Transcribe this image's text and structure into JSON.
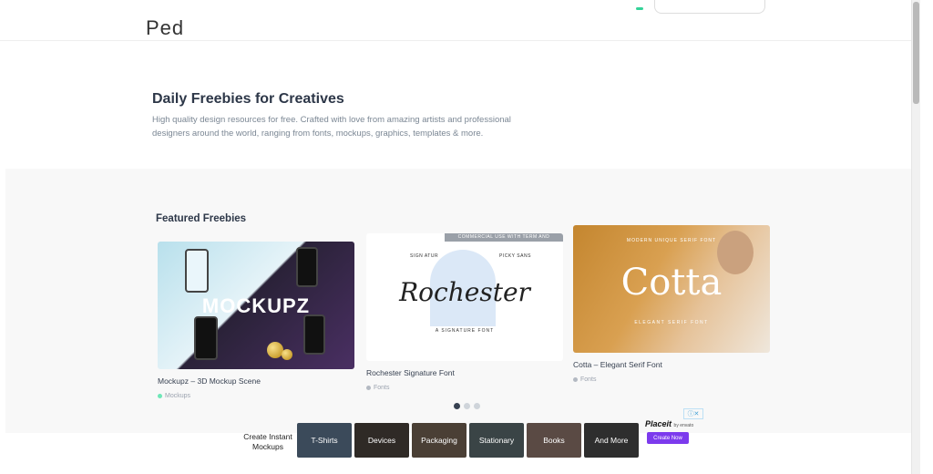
{
  "header": {
    "title_fragment": "Ped"
  },
  "hero": {
    "title": "Daily Freebies for Creatives",
    "description": "High quality design resources for free. Crafted with love from amazing artists and professional designers around the world, ranging from fonts, mockups, graphics, templates & more."
  },
  "featured": {
    "title": "Featured Freebies",
    "cards": [
      {
        "title": "Mockupz – 3D Mockup Scene",
        "category": "Mockups",
        "thumb_text": "MOCKUPZ"
      },
      {
        "title": "Rochester Signature Font",
        "category": "Fonts",
        "thumb_text": "Rochester",
        "thumb_banner": "COMMERCIAL USE WITH TERM AND CONDITION",
        "thumb_sub": "A SIGNATURE FONT",
        "thumb_left": "SIGN ATUR",
        "thumb_right": "PICKY SANS"
      },
      {
        "title": "Cotta – Elegant Serif Font",
        "category": "Fonts",
        "thumb_text": "Cotta",
        "thumb_sub": "ELEGANT SERIF FONT",
        "thumb_top": "MODERN UNIQUE SERIF FONT"
      }
    ],
    "carousel": {
      "pages": 3,
      "active": 1
    }
  },
  "ad": {
    "lead": "Create Instant Mockups",
    "tiles": [
      "T-Shirts",
      "Devices",
      "Packaging",
      "Stationary",
      "Books",
      "And More"
    ],
    "brand": "Placeit",
    "brand_sub": "by envato",
    "cta": "Create Now",
    "close_label": "ⓘ✕"
  },
  "colors": {
    "accent": "#7c3aed",
    "category_dot_mockups": "#6ee7b7",
    "category_dot_fonts": "#b3b9c2"
  }
}
